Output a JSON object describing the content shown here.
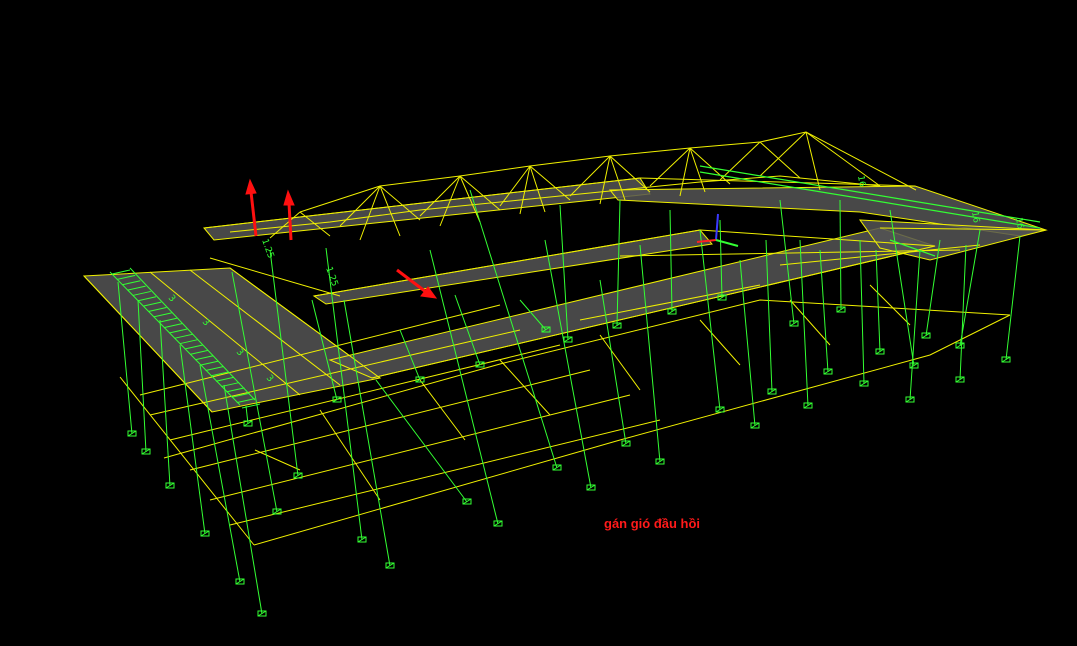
{
  "viewport": {
    "background": "#000000",
    "frame_color": "#f0f000",
    "column_color": "#33ff33",
    "slab_color": "#555555",
    "load_arrow_color": "#ff1010",
    "support_icon": "fixed-support-icon",
    "axis_icon": "xyz-axis-triad-icon"
  },
  "annotation": {
    "text": "gán gió đầu hồi"
  },
  "load_labels": {
    "wing_left": "3",
    "wing_mid": "3",
    "wing_low": "3",
    "wing_bottom": "3",
    "top_left": "1.25",
    "top_mid": "1.25",
    "right_beam_a": "16",
    "right_beam_b": "16",
    "right_beam_c": "16"
  }
}
